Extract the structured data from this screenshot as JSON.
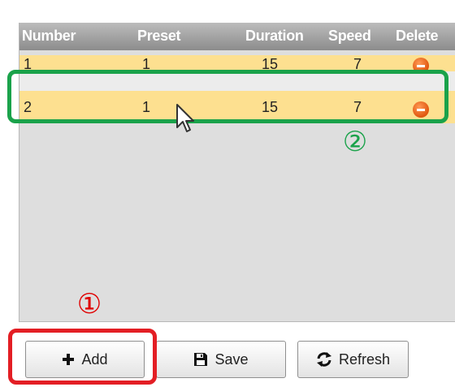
{
  "table": {
    "headers": {
      "number": "Number",
      "preset": "Preset",
      "duration": "Duration",
      "speed": "Speed",
      "delete": "Delete"
    },
    "rows": [
      {
        "number": "1",
        "preset": "1",
        "duration": "15",
        "speed": "7",
        "delete_icon": "minus-circle-icon"
      },
      {
        "number": "2",
        "preset": "1",
        "duration": "15",
        "speed": "7",
        "delete_icon": "minus-circle-icon"
      }
    ]
  },
  "buttons": {
    "add": {
      "label": "Add",
      "icon": "plus-icon"
    },
    "save": {
      "label": "Save",
      "icon": "floppy-disk-icon"
    },
    "refresh": {
      "label": "Refresh",
      "icon": "refresh-arrows-icon"
    }
  },
  "annotations": {
    "marker_1": "①",
    "marker_2": "②",
    "colors": {
      "green": "#1aa24a",
      "red": "#e31e24"
    }
  },
  "colors": {
    "row_highlight": "#fde090",
    "header_bg": "#9a9a9a",
    "panel_bg": "#dedede",
    "delete_icon": "#e0560e"
  }
}
